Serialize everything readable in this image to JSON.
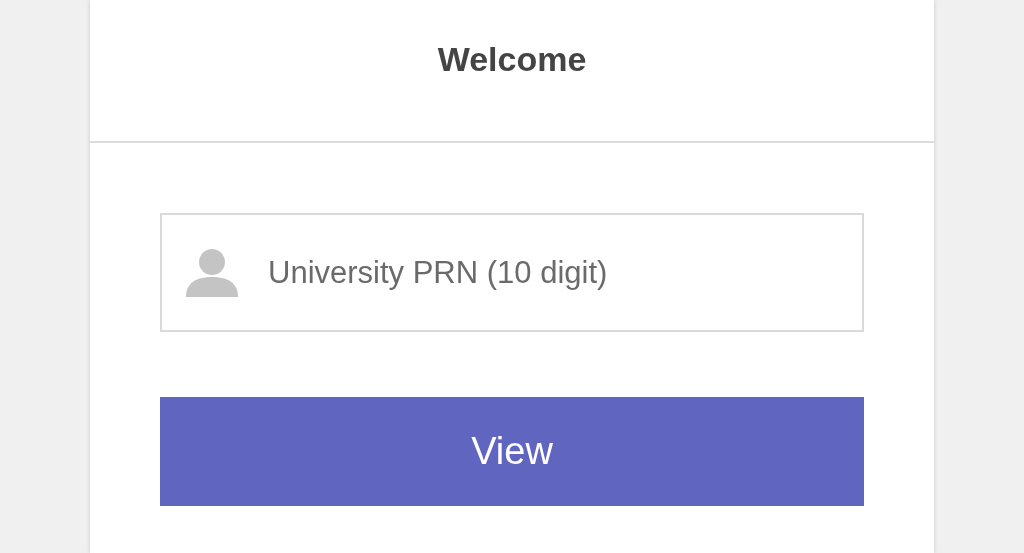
{
  "header": {
    "title": "Welcome"
  },
  "form": {
    "prn_field": {
      "placeholder": "University PRN (10 digit)"
    },
    "submit_button": {
      "label": "View"
    }
  }
}
